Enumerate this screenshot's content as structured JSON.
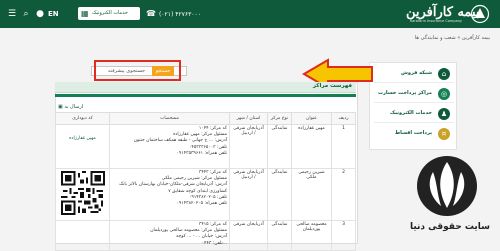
{
  "header": {
    "logo_text": "بیمه کارآفرین",
    "logo_subtitle": "Karafarin Insurance Company",
    "language": "EN",
    "services_button": "خدمات الکترونیک",
    "phone": "(۰۲۱) ۴۲۷۶۳۰۰۰",
    "colors": {
      "primary": "#0f5a3b",
      "accent": "#f4a41b",
      "highlight": "#e02b20"
    }
  },
  "breadcrumb": "بیمه کارآفرین » شعب و نمایندگی ها",
  "sidebar": {
    "items": [
      {
        "label": "شبکه فروش",
        "icon": "network-icon"
      },
      {
        "label": "مراکز پرداخت خسارت",
        "icon": "target-icon"
      },
      {
        "label": "خدمات الکترونیک",
        "icon": "people-icon"
      },
      {
        "label": "پرداخت اقساط",
        "icon": "coins-icon"
      }
    ]
  },
  "search": {
    "placeholder": "",
    "button_label": "جستجو",
    "advanced_label": "جستجوی پیشرفته"
  },
  "panel": {
    "title": "فهرست مراکز",
    "export_label": "ارسال به"
  },
  "table": {
    "columns": [
      "ردیف",
      "عنوان",
      "نوع مرکز",
      "استان / شهر",
      "مشخصات",
      "کد دیوداری"
    ],
    "rows": [
      {
        "index": "1",
        "title": "مهین غفارزاده",
        "type": "نمایندگی",
        "province": "آذربایجان شرقی / اردبیل",
        "desc": [
          "کد مرکز: ۱۰۴۴",
          "مسئول مرکز: مهین غفارزاده",
          "آدرس: ... خ جهانی - طبقه همکف ساختمان جنتون",
          "تلفن: ۰۴۵۳۳۳۶۵۰۰۳",
          "تلفن همراه: ۰۹۱۴۳۵۳۹۶۶۱"
        ],
        "qr_caption": "مهین غفارزاده"
      },
      {
        "index": "2",
        "title": "شیرین رحیمی ملکی",
        "type": "نمایندگی",
        "province": "آذربایجان شرقی / اردبیل",
        "desc": [
          "کد مرکز: ۳۴۴۳",
          "مسئول مرکز: شیرین رحیمی ملکی",
          "آدرس: آذربایجان شرقی-ملکان-خیابان بهارستان بالاتر بانک",
          "کشاورزی ابتدای کوچه شقایق ۷",
          "تلفن: ۰۹۱۴۳۸۲۰۲۰۵",
          "تلفن همراه: ۰۹۱۴۳۸۲۰۲۰۵"
        ],
        "qr_caption": ""
      },
      {
        "index": "3",
        "title": "معصومه صالحی پوردیلمان",
        "type": "نمایندگی",
        "province": "آذربایجان شرقی",
        "desc": [
          "کد مرکز: ۳۴۱۵",
          "مسئول مرکز: معصومه صالحی پوردیلمان",
          "آدرس: خیابان ... - ... کوچه",
          "تلفن: ۰۴۴۳..."
        ],
        "qr_caption": ""
      }
    ]
  },
  "watermark": {
    "text": "سایت حقوقی دنیا"
  }
}
